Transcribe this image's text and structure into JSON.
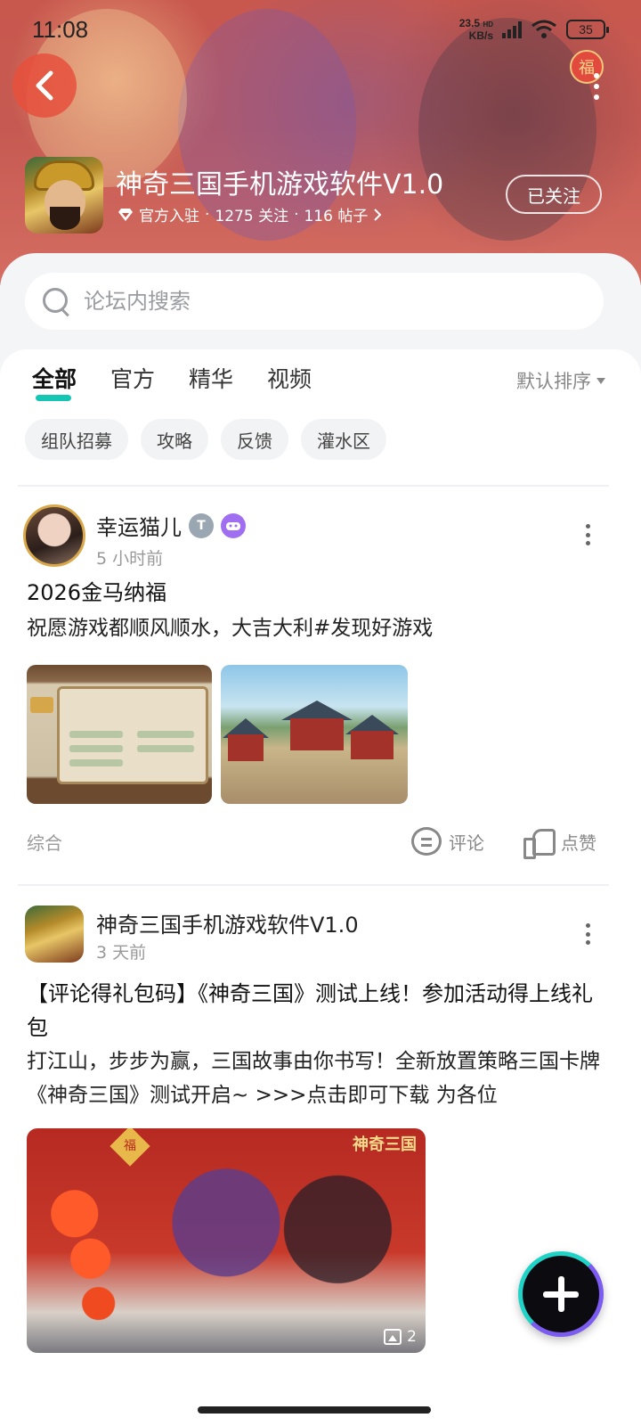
{
  "status_bar": {
    "time": "11:08",
    "net_speed_value": "23.5",
    "net_speed_unit": "KB/s",
    "hd_label": "HD",
    "battery": "35"
  },
  "header": {
    "back_icon": "chevron-left-icon",
    "more_icon": "more-vertical-icon",
    "fu_badge": "福",
    "game_title": "神奇三国手机游戏软件V1.0",
    "official_label": "官方入驻",
    "followers": "1275 关注",
    "posts": "116 帖子",
    "follow_button": "已关注"
  },
  "search": {
    "placeholder": "论坛内搜索"
  },
  "tabs": {
    "items": [
      {
        "label": "全部",
        "active": true
      },
      {
        "label": "官方",
        "active": false
      },
      {
        "label": "精华",
        "active": false
      },
      {
        "label": "视频",
        "active": false
      }
    ],
    "sort_label": "默认排序"
  },
  "chips": [
    "组队招募",
    "攻略",
    "反馈",
    "灌水区"
  ],
  "posts": [
    {
      "author": "幸运猫儿",
      "time": "5 小时前",
      "title": "2026金马纳福",
      "body": "祝愿游戏都顺风顺水，大吉大利#发现好游戏",
      "category": "综合",
      "comment_label": "评论",
      "like_label": "点赞"
    },
    {
      "author": "神奇三国手机游戏软件V1.0",
      "time": "3 天前",
      "title": "【评论得礼包码】《神奇三国》测试上线！参加活动得上线礼包",
      "body": "打江山，步步为赢，三国故事由你书写！全新放置策略三国卡牌《神奇三国》测试开启~ >>>点击即可下载 为各位",
      "image_logo": "神奇三国",
      "image_fu": "福",
      "image_count": "2"
    }
  ],
  "colors": {
    "accent": "#16c6b4",
    "header_red": "#c8584e",
    "fab_bg": "#0c0c10"
  }
}
